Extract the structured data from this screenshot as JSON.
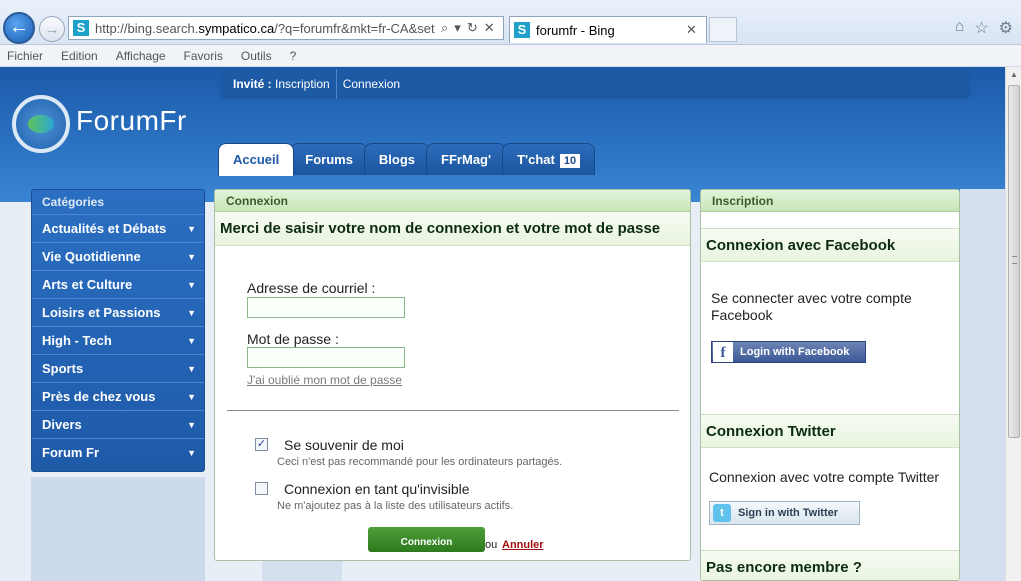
{
  "browser": {
    "url_prefix": "http://bing.search.",
    "url_domain": "sympatico.ca",
    "url_rest": "/?q=forumfr&mkt=fr-CA&setLa",
    "tab_title": "forumfr - Bing",
    "site_icon_letter": "S"
  },
  "menubar": [
    "Fichier",
    "Edition",
    "Affichage",
    "Favoris",
    "Outils",
    "?"
  ],
  "site": {
    "logo_text": "ForumFr",
    "user_label": "Invité :",
    "inscription_link": "Inscription",
    "connexion_link": "Connexion"
  },
  "tabs": [
    {
      "label": "Accueil",
      "active": true
    },
    {
      "label": "Forums"
    },
    {
      "label": "Blogs"
    },
    {
      "label": "FFrMag'"
    },
    {
      "label": "T'chat",
      "badge": "10"
    }
  ],
  "sidebar": {
    "title": "Catégories",
    "items": [
      "Actualités et Débats",
      "Vie Quotidienne",
      "Arts et Culture",
      "Loisirs et Passions",
      "High - Tech",
      "Sports",
      "Près de chez vous",
      "Divers",
      "Forum Fr"
    ]
  },
  "login": {
    "header": "Connexion",
    "subtitle": "Merci de saisir votre nom de connexion et votre mot de passe",
    "email_label": "Adresse de courriel :",
    "email_value": "",
    "password_label": "Mot de passe :",
    "password_value": "",
    "forgot_link": "J'ai oublié mon mot de passe",
    "remember_label": "Se souvenir de moi",
    "remember_checked": true,
    "remember_note": "Ceci n'est pas recommandé pour les ordinateurs partagés.",
    "invisible_label": "Connexion en tant qu'invisible",
    "invisible_checked": false,
    "invisible_note": "Ne m'ajoutez pas à la liste des utilisateurs actifs.",
    "submit_label": "Connexion",
    "or_text": "ou",
    "cancel_link": "Annuler"
  },
  "register": {
    "header": "Inscription",
    "facebook_title": "Connexion avec Facebook",
    "facebook_text": "Se connecter avec votre compte Facebook",
    "facebook_button": "Login with Facebook",
    "twitter_title": "Connexion Twitter",
    "twitter_text": "Connexion avec votre compte Twitter",
    "twitter_button": "Sign in with Twitter",
    "not_member": "Pas encore membre ?"
  }
}
